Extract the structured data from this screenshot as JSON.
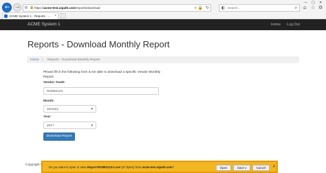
{
  "browser": {
    "url_prefix": "https://",
    "url_host": "acme-test.uipath.com",
    "url_path": "/reports/download",
    "search_placeholder": "Search...",
    "tab_title": "ACME System 1 - Reports - ...",
    "window_minimize": "—",
    "window_maximize": "□",
    "window_close": "✕"
  },
  "navbar": {
    "brand": "ACME System 1",
    "home": "Home",
    "logout": "Log Out"
  },
  "page": {
    "title": "Reports - Download Monthly Report",
    "breadcrumb": {
      "home": "Home",
      "separator": "/",
      "current": "Reports - Download Monthly Report"
    },
    "intro": "Please fill in the following form to be able to download a specific Vendor Monthly Report:",
    "form": {
      "vendor_label": "Vendor TaxID:",
      "vendor_value": "RO892123",
      "month_label": "Month:",
      "month_value": "January",
      "year_label": "Year:",
      "year_value": "2017",
      "submit_label": "Download Report"
    },
    "footer": "Copyright © 2"
  },
  "download_bar": {
    "prefix": "Do you want to open or save ",
    "file": "Report-RO892123-1.csv",
    "size": " (37 bytes) from ",
    "host": "acme-test.uipath.com",
    "suffix": "?",
    "open": "Open",
    "save": "Save",
    "cancel": "Cancel"
  },
  "colors": {
    "navbar_bg": "#222222",
    "primary_button": "#337ab7",
    "download_bar_bg": "#f3b623",
    "link": "#337ab7"
  }
}
